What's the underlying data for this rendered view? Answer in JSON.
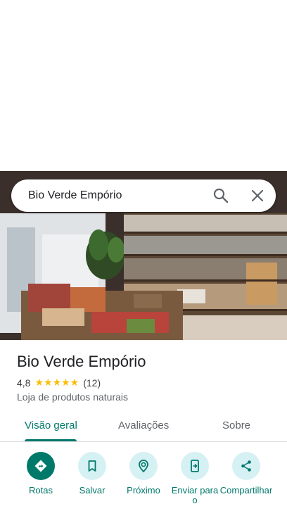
{
  "search": {
    "query": "Bio Verde Empório"
  },
  "place": {
    "name": "Bio Verde Empório",
    "rating": "4,8",
    "stars": "★★★★★",
    "reviews": "(12)",
    "category": "Loja de produtos naturais"
  },
  "tabs": [
    {
      "label": "Visão geral",
      "active": true
    },
    {
      "label": "Avaliações"
    },
    {
      "label": "Sobre"
    }
  ],
  "actions": [
    {
      "label": "Rotas",
      "icon": "directions-icon"
    },
    {
      "label": "Salvar",
      "icon": "bookmark-icon"
    },
    {
      "label": "Próximo",
      "icon": "nearby-icon"
    },
    {
      "label": "Enviar para o",
      "icon": "send-to-phone-icon"
    },
    {
      "label": "Compartilhar",
      "icon": "share-icon"
    }
  ],
  "colors": {
    "accent": "#00796b",
    "action_bg": "#d6f1f4",
    "star": "#fbbc04"
  }
}
